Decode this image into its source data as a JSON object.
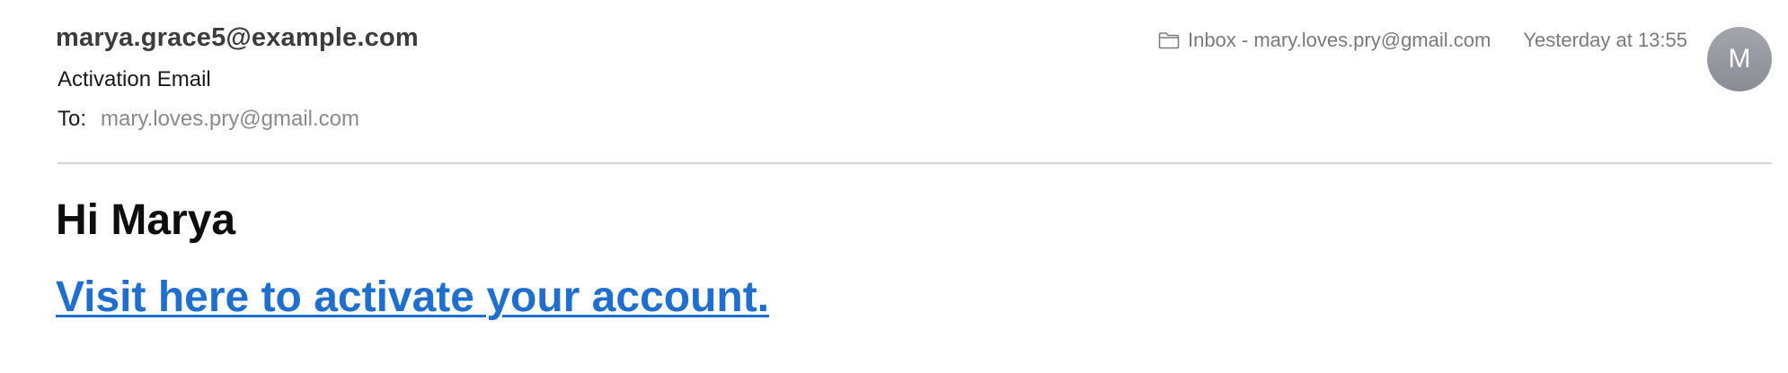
{
  "header": {
    "sender": "marya.grace5@example.com",
    "subject": "Activation Email",
    "to_label": "To:",
    "to_value": "mary.loves.pry@gmail.com",
    "mailbox": "Inbox - mary.loves.pry@gmail.com",
    "date": "Yesterday at 13:55",
    "avatar_initial": "M",
    "icons": {
      "mailbox": "folder-icon"
    }
  },
  "body": {
    "greeting": "Hi Marya",
    "link_text": "Visit here to activate your account."
  },
  "colors": {
    "link": "#1f6fd1",
    "avatar": "#9a9ca3",
    "muted_text": "#8a8a8a"
  }
}
